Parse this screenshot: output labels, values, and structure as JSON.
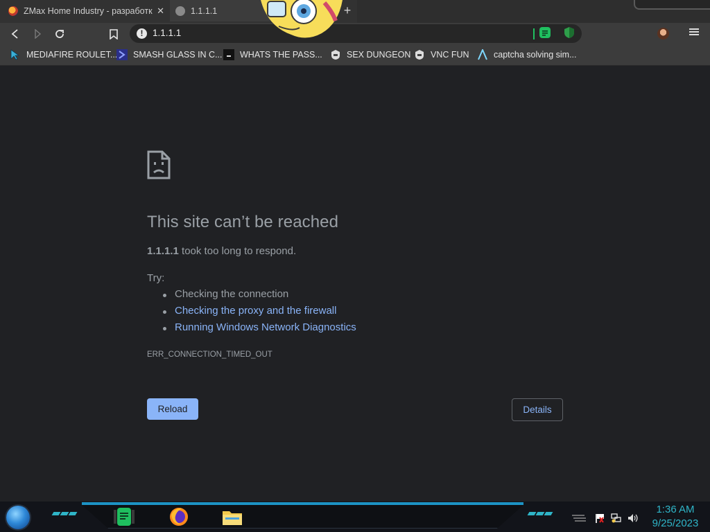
{
  "tabs": [
    {
      "title": "ZMax Home Industry - разработк",
      "active": false,
      "favicon": "firefox-like-icon"
    },
    {
      "title": "1.1.1.1",
      "active": true,
      "favicon": "globe-icon"
    }
  ],
  "toolbar": {
    "url": "1.1.1.1",
    "security_icon": "info-icon"
  },
  "bookmarks": [
    {
      "label": "MEDIAFIRE ROULET...",
      "icon": "cursor-icon"
    },
    {
      "label": "SMASH GLASS IN C...",
      "icon": "chevron-icon"
    },
    {
      "label": "WHATS THE PASS...",
      "icon": "terminal-icon"
    },
    {
      "label": "SEX DUNGEON",
      "icon": "shield-icon"
    },
    {
      "label": "VNC FUN",
      "icon": "shield-icon"
    },
    {
      "label": "captcha solving sim...",
      "icon": "lambda-icon"
    }
  ],
  "error": {
    "title": "This site can’t be reached",
    "host": "1.1.1.1",
    "message": " took too long to respond.",
    "try_label": "Try:",
    "suggestions": [
      {
        "text": "Checking the connection",
        "link": false
      },
      {
        "text": "Checking the proxy and the firewall",
        "link": true
      },
      {
        "text": "Running Windows Network Diagnostics",
        "link": true
      }
    ],
    "code": "ERR_CONNECTION_TIMED_OUT",
    "reload_label": "Reload",
    "details_label": "Details"
  },
  "taskbar": {
    "time": "1:36 AM",
    "date": "9/25/2023",
    "apps": [
      "notes-app-icon",
      "firefox-icon",
      "file-explorer-icon"
    ]
  },
  "colors": {
    "page_bg": "#202124",
    "text_muted": "#9aa0a6",
    "link": "#8ab4f8",
    "accent_cyan": "#2fb5c8"
  }
}
